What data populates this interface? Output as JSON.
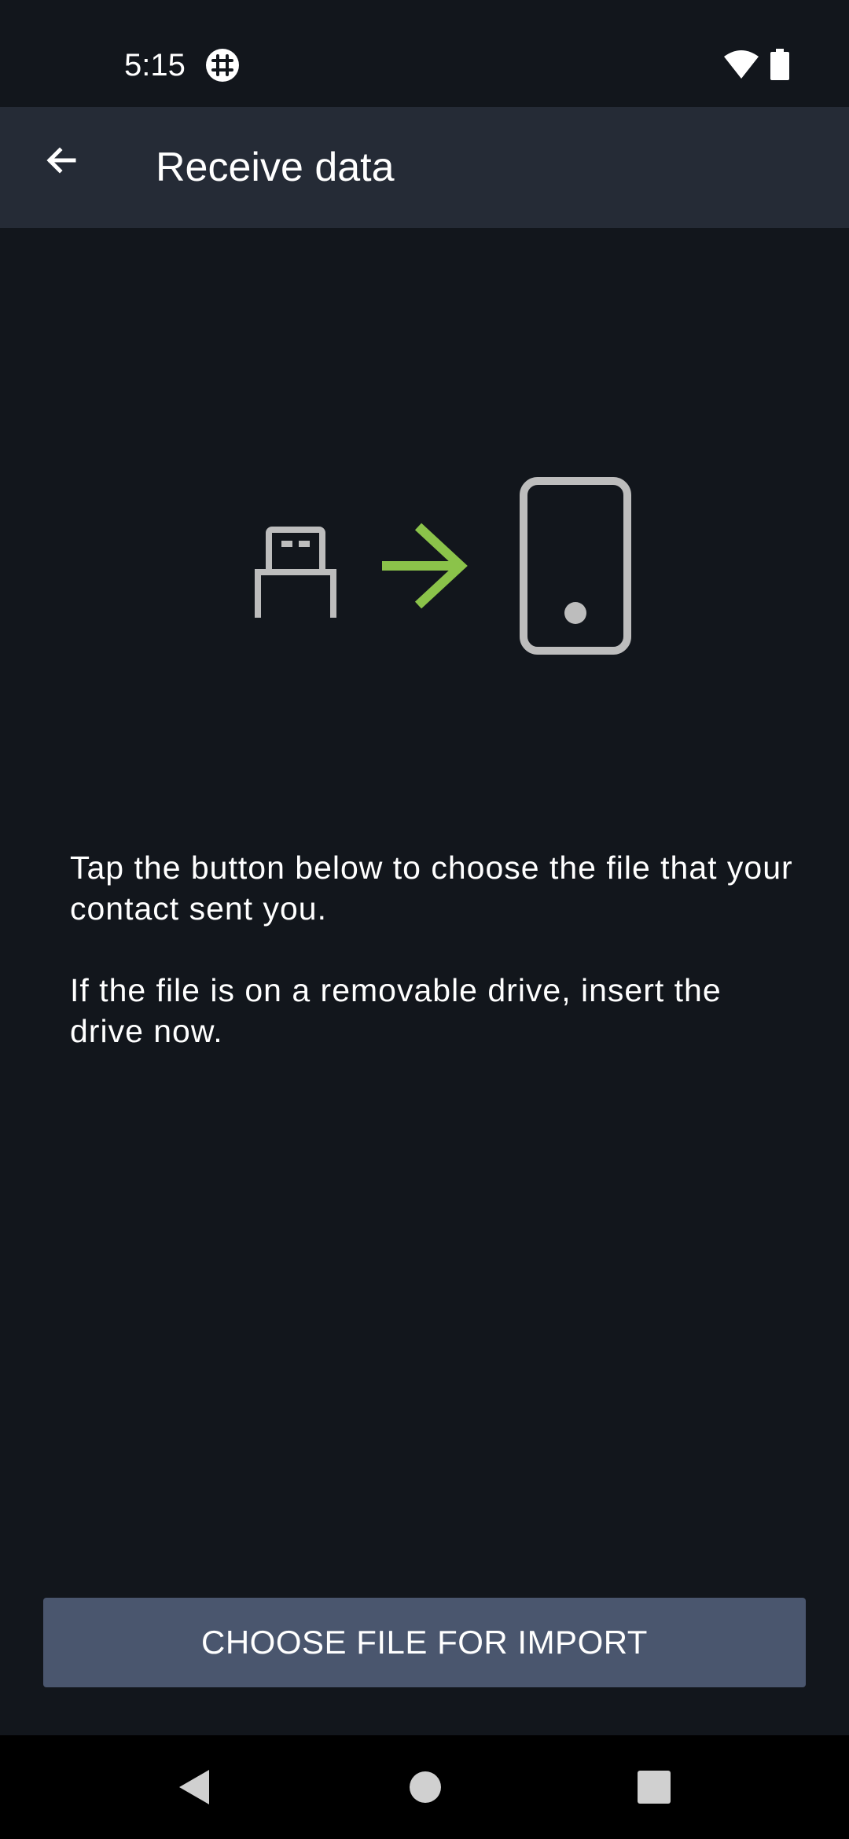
{
  "status_bar": {
    "time": "5:15",
    "app_icon": "matrix-hash-icon",
    "wifi_icon": "wifi-icon",
    "battery_icon": "battery-icon"
  },
  "app_bar": {
    "back_icon": "arrow-back-icon",
    "title": "Receive data"
  },
  "illustration": {
    "source_icon": "usb-drive-icon",
    "arrow_icon": "arrow-right-icon",
    "target_icon": "phone-icon",
    "arrow_color": "#8bc34a",
    "icon_color": "#bdbdbd"
  },
  "message": {
    "paragraph1": "Tap the button below to choose the file that your contact sent you.",
    "paragraph2": "If the file is on a removable drive, insert the drive now."
  },
  "import_button": {
    "label": "CHOOSE FILE FOR IMPORT"
  },
  "nav_bar": {
    "back_icon": "nav-back-icon",
    "home_icon": "nav-home-icon",
    "recents_icon": "nav-recents-icon"
  },
  "colors": {
    "background": "#12161c",
    "app_bar": "#252b36",
    "button": "#4a566e",
    "accent": "#8bc34a"
  }
}
